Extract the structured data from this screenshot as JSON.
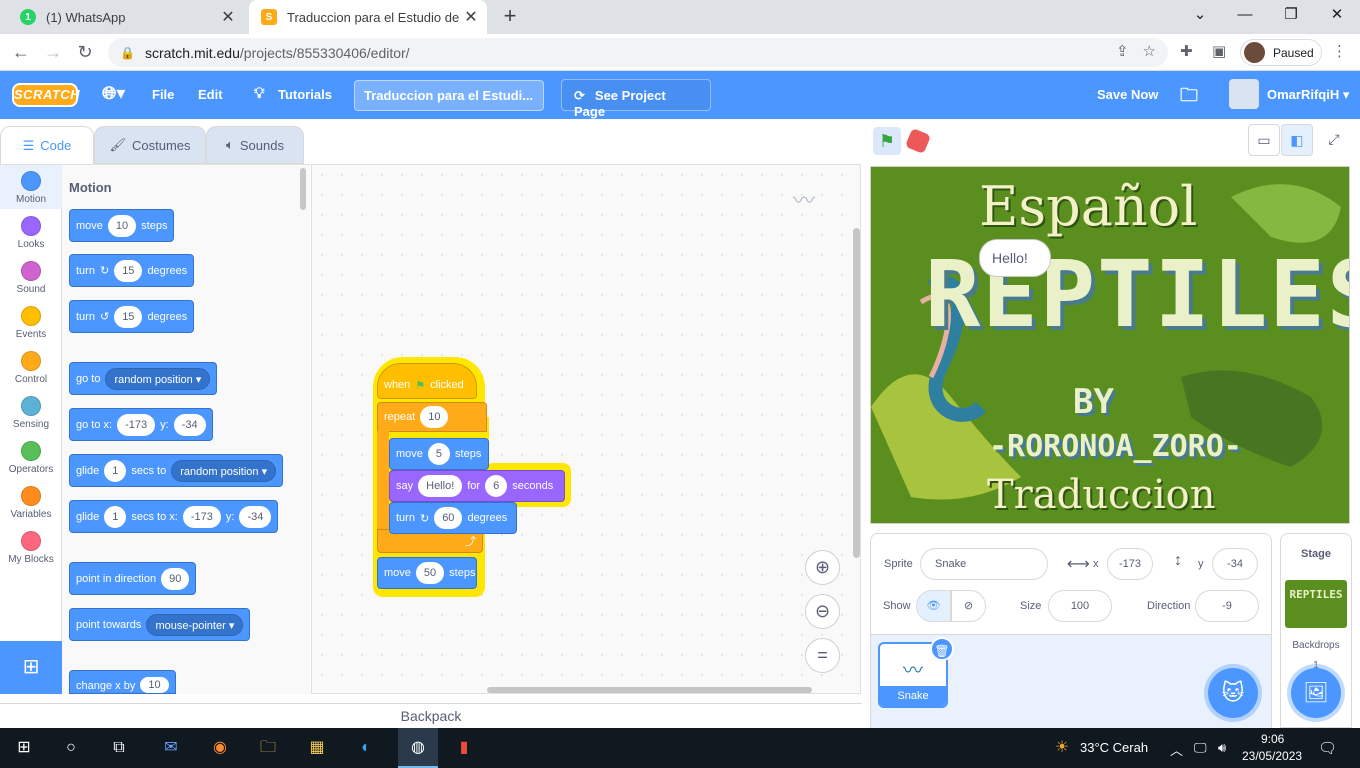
{
  "browser": {
    "tabs": [
      {
        "title": "(1) WhatsApp",
        "badge": "1"
      },
      {
        "title": "Traduccion para el Estudio de Re"
      }
    ],
    "url_host": "scratch.mit.edu",
    "url_path": "/projects/855330406/editor/",
    "profile_status": "Paused"
  },
  "menubar": {
    "logo": "SCRATCH",
    "file": "File",
    "edit": "Edit",
    "tutorials": "Tutorials",
    "project_title": "Traduccion para el Estudi...",
    "see_project": "See Project Page",
    "save_now": "Save Now",
    "username": "OmarRifqiH"
  },
  "editor_tabs": {
    "code": "Code",
    "costumes": "Costumes",
    "sounds": "Sounds"
  },
  "categories": [
    {
      "label": "Motion",
      "color": "#4c97ff"
    },
    {
      "label": "Looks",
      "color": "#9966ff"
    },
    {
      "label": "Sound",
      "color": "#cf63cf"
    },
    {
      "label": "Events",
      "color": "#ffbf00"
    },
    {
      "label": "Control",
      "color": "#ffab19"
    },
    {
      "label": "Sensing",
      "color": "#5cb1d6"
    },
    {
      "label": "Operators",
      "color": "#59c059"
    },
    {
      "label": "Variables",
      "color": "#ff8c1a"
    },
    {
      "label": "My Blocks",
      "color": "#ff6680"
    }
  ],
  "palette": {
    "heading": "Motion",
    "move": {
      "a": "move",
      "v": "10",
      "b": "steps"
    },
    "turn_cw": {
      "a": "turn",
      "v": "15",
      "b": "degrees"
    },
    "turn_ccw": {
      "a": "turn",
      "v": "15",
      "b": "degrees"
    },
    "goto": {
      "a": "go to",
      "d": "random position"
    },
    "gotoxy": {
      "a": "go to x:",
      "x": "-173",
      "b": "y:",
      "y": "-34"
    },
    "glide": {
      "a": "glide",
      "v": "1",
      "b": "secs to",
      "d": "random position"
    },
    "glidexy": {
      "a": "glide",
      "v": "1",
      "b": "secs to x:",
      "x": "-173",
      "c": "y:",
      "y": "-34"
    },
    "point_dir": {
      "a": "point in direction",
      "v": "90"
    },
    "point_towards": {
      "a": "point towards",
      "d": "mouse-pointer"
    },
    "change_x": {
      "a": "change x by",
      "v": "10"
    }
  },
  "script": {
    "hat": {
      "a": "when",
      "b": "clicked"
    },
    "repeat": {
      "a": "repeat",
      "v": "10"
    },
    "move": {
      "a": "move",
      "v": "5",
      "b": "steps"
    },
    "say": {
      "a": "say",
      "v": "Hello!",
      "b": "for",
      "n": "6",
      "c": "seconds"
    },
    "turn": {
      "a": "turn",
      "v": "60",
      "b": "degrees"
    },
    "move2": {
      "a": "move",
      "v": "50",
      "b": "steps"
    }
  },
  "backpack": "Backpack",
  "stage": {
    "title": "Español",
    "big": "REPTILES",
    "by": "BY",
    "author": "-RORONOA_ZORO-",
    "subtitle": "Traduccion",
    "bubble": "Hello!"
  },
  "sprite_info": {
    "sprite_label": "Sprite",
    "sprite_name": "Snake",
    "x_label": "x",
    "x": "-173",
    "y_label": "y",
    "y": "-34",
    "show_label": "Show",
    "size_label": "Size",
    "size": "100",
    "direction_label": "Direction",
    "direction": "-9",
    "sprite_card": "Snake"
  },
  "stage_panel": {
    "label": "Stage",
    "backdrops_label": "Backdrops",
    "backdrops_count": "1",
    "thumb_text": "REPTILES"
  },
  "taskbar": {
    "weather": "33°C  Cerah",
    "time": "9:06",
    "date": "23/05/2023"
  }
}
